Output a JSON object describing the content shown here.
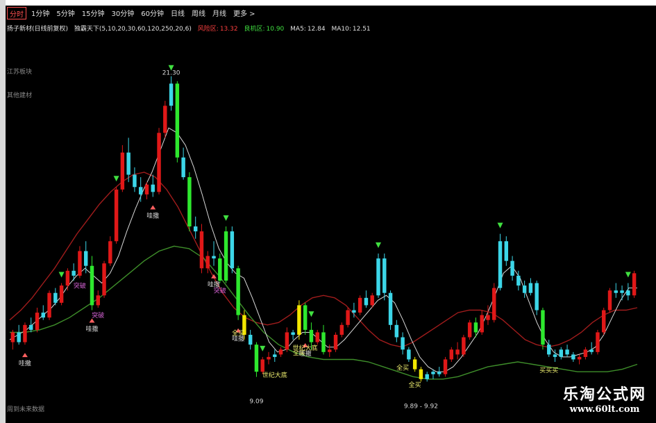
{
  "toolbar": {
    "periods": [
      "分时",
      "1分钟",
      "5分钟",
      "15分钟",
      "30分钟",
      "60分钟",
      "日线",
      "周线",
      "月线",
      "更多 >"
    ],
    "active_index": 0
  },
  "info": {
    "name": "扬子新材(日线前复权)",
    "indicator": "独霸天下(5,10,20,30,60,120,250,20,6)",
    "risk_label": "风险区:",
    "risk_value": "13.32",
    "chance_label": "良机区:",
    "chance_value": "10.90",
    "ma5_label": "MA5:",
    "ma5_value": "12.84",
    "ma10_label": "MA10:",
    "ma10_value": "12.51"
  },
  "side": {
    "block": "江苏板块",
    "industry": "其他建材",
    "future": "周到未来数据"
  },
  "watermark": {
    "title": "乐淘公式网",
    "url": "www.60lt.com"
  },
  "colors": {
    "background": "#000000",
    "up_red": "#e01818",
    "down_cyan": "#3cd6e8",
    "green_bar": "#2ee82e",
    "yellow_bar": "#f2e600",
    "red_curve": "#a01c1c",
    "green_curve": "#3e8e2a",
    "white_curve": "#d8d8d8",
    "signal_magenta": "#d060d0"
  },
  "chart_data": {
    "type": "candlestick",
    "candles": [
      {
        "o": 10.5,
        "h": 11.0,
        "l": 10.2,
        "c": 10.9,
        "k": "red"
      },
      {
        "o": 10.9,
        "h": 11.2,
        "l": 10.4,
        "c": 10.5,
        "k": "cyan"
      },
      {
        "o": 10.5,
        "h": 11.3,
        "l": 10.4,
        "c": 11.2,
        "k": "red"
      },
      {
        "o": 11.2,
        "h": 11.5,
        "l": 10.9,
        "c": 11.0,
        "k": "cyan"
      },
      {
        "o": 11.0,
        "h": 11.9,
        "l": 10.9,
        "c": 11.7,
        "k": "red"
      },
      {
        "o": 11.7,
        "h": 12.0,
        "l": 11.4,
        "c": 11.5,
        "k": "cyan"
      },
      {
        "o": 11.5,
        "h": 12.6,
        "l": 11.4,
        "c": 12.5,
        "k": "red"
      },
      {
        "o": 12.5,
        "h": 12.7,
        "l": 12.0,
        "c": 12.1,
        "k": "cyan"
      },
      {
        "o": 12.1,
        "h": 12.9,
        "l": 12.0,
        "c": 12.8,
        "k": "red"
      },
      {
        "o": 12.8,
        "h": 13.5,
        "l": 12.6,
        "c": 13.4,
        "k": "red"
      },
      {
        "o": 13.4,
        "h": 13.7,
        "l": 13.0,
        "c": 13.2,
        "k": "cyan"
      },
      {
        "o": 13.2,
        "h": 14.4,
        "l": 13.1,
        "c": 14.2,
        "k": "red"
      },
      {
        "o": 14.2,
        "h": 14.6,
        "l": 13.3,
        "c": 13.6,
        "k": "cyan"
      },
      {
        "o": 13.6,
        "h": 14.0,
        "l": 11.8,
        "c": 12.0,
        "k": "green"
      },
      {
        "o": 12.0,
        "h": 12.6,
        "l": 11.9,
        "c": 12.4,
        "k": "red"
      },
      {
        "o": 12.4,
        "h": 13.8,
        "l": 12.3,
        "c": 13.7,
        "k": "red"
      },
      {
        "o": 13.7,
        "h": 14.8,
        "l": 13.6,
        "c": 14.6,
        "k": "red"
      },
      {
        "o": 14.6,
        "h": 16.8,
        "l": 14.5,
        "c": 16.7,
        "k": "red"
      },
      {
        "o": 16.7,
        "h": 18.5,
        "l": 16.6,
        "c": 18.2,
        "k": "red"
      },
      {
        "o": 18.2,
        "h": 18.8,
        "l": 17.0,
        "c": 17.3,
        "k": "cyan"
      },
      {
        "o": 17.3,
        "h": 17.6,
        "l": 16.6,
        "c": 16.8,
        "k": "cyan"
      },
      {
        "o": 16.8,
        "h": 17.2,
        "l": 16.2,
        "c": 16.5,
        "k": "cyan"
      },
      {
        "o": 16.5,
        "h": 17.0,
        "l": 16.3,
        "c": 16.9,
        "k": "red"
      },
      {
        "o": 16.9,
        "h": 17.3,
        "l": 16.4,
        "c": 16.6,
        "k": "cyan"
      },
      {
        "o": 16.6,
        "h": 19.2,
        "l": 16.5,
        "c": 19.0,
        "k": "red"
      },
      {
        "o": 19.0,
        "h": 20.3,
        "l": 18.8,
        "c": 20.1,
        "k": "red"
      },
      {
        "o": 20.1,
        "h": 21.3,
        "l": 19.9,
        "c": 21.0,
        "k": "cyan"
      },
      {
        "o": 21.0,
        "h": 21.1,
        "l": 17.8,
        "c": 18.0,
        "k": "green"
      },
      {
        "o": 18.0,
        "h": 18.4,
        "l": 17.1,
        "c": 17.2,
        "k": "cyan"
      },
      {
        "o": 17.2,
        "h": 17.4,
        "l": 15.0,
        "c": 15.2,
        "k": "green"
      },
      {
        "o": 15.2,
        "h": 15.6,
        "l": 14.7,
        "c": 15.0,
        "k": "cyan"
      },
      {
        "o": 15.0,
        "h": 15.3,
        "l": 13.3,
        "c": 13.5,
        "k": "red"
      },
      {
        "o": 13.5,
        "h": 14.2,
        "l": 13.3,
        "c": 14.0,
        "k": "red"
      },
      {
        "o": 14.0,
        "h": 14.6,
        "l": 13.6,
        "c": 13.9,
        "k": "cyan"
      },
      {
        "o": 13.9,
        "h": 14.1,
        "l": 12.9,
        "c": 13.0,
        "k": "green"
      },
      {
        "o": 13.0,
        "h": 15.2,
        "l": 12.9,
        "c": 15.0,
        "k": "green"
      },
      {
        "o": 15.0,
        "h": 15.2,
        "l": 13.3,
        "c": 13.5,
        "k": "cyan"
      },
      {
        "o": 13.5,
        "h": 13.6,
        "l": 11.4,
        "c": 11.6,
        "k": "green"
      },
      {
        "o": 11.6,
        "h": 11.8,
        "l": 10.6,
        "c": 10.8,
        "k": "yellow"
      },
      {
        "o": 10.8,
        "h": 11.0,
        "l": 10.2,
        "c": 10.4,
        "k": "cyan"
      },
      {
        "o": 10.4,
        "h": 10.5,
        "l": 9.09,
        "c": 9.3,
        "k": "green"
      },
      {
        "o": 9.3,
        "h": 9.9,
        "l": 9.2,
        "c": 9.8,
        "k": "red"
      },
      {
        "o": 9.8,
        "h": 10.1,
        "l": 9.6,
        "c": 9.9,
        "k": "red"
      },
      {
        "o": 9.9,
        "h": 10.2,
        "l": 9.7,
        "c": 10.0,
        "k": "cyan"
      },
      {
        "o": 10.0,
        "h": 10.3,
        "l": 9.9,
        "c": 10.2,
        "k": "red"
      },
      {
        "o": 10.2,
        "h": 11.1,
        "l": 10.1,
        "c": 10.9,
        "k": "red"
      },
      {
        "o": 10.9,
        "h": 11.0,
        "l": 10.6,
        "c": 10.8,
        "k": "cyan"
      },
      {
        "o": 10.8,
        "h": 12.2,
        "l": 10.6,
        "c": 12.0,
        "k": "yellow"
      },
      {
        "o": 12.0,
        "h": 12.1,
        "l": 10.8,
        "c": 11.0,
        "k": "green"
      },
      {
        "o": 11.0,
        "h": 11.3,
        "l": 10.2,
        "c": 10.5,
        "k": "green"
      },
      {
        "o": 10.5,
        "h": 11.0,
        "l": 10.4,
        "c": 10.9,
        "k": "red"
      },
      {
        "o": 10.9,
        "h": 11.2,
        "l": 10.0,
        "c": 10.1,
        "k": "green"
      },
      {
        "o": 10.1,
        "h": 10.4,
        "l": 9.9,
        "c": 10.2,
        "k": "red"
      },
      {
        "o": 10.2,
        "h": 10.9,
        "l": 10.1,
        "c": 10.8,
        "k": "red"
      },
      {
        "o": 10.8,
        "h": 11.3,
        "l": 10.7,
        "c": 11.2,
        "k": "red"
      },
      {
        "o": 11.2,
        "h": 11.9,
        "l": 11.1,
        "c": 11.8,
        "k": "red"
      },
      {
        "o": 11.8,
        "h": 12.1,
        "l": 11.5,
        "c": 11.7,
        "k": "cyan"
      },
      {
        "o": 11.7,
        "h": 12.4,
        "l": 11.6,
        "c": 12.3,
        "k": "red"
      },
      {
        "o": 12.3,
        "h": 12.6,
        "l": 11.9,
        "c": 12.0,
        "k": "cyan"
      },
      {
        "o": 12.0,
        "h": 12.5,
        "l": 11.9,
        "c": 12.4,
        "k": "red"
      },
      {
        "o": 12.4,
        "h": 14.1,
        "l": 12.3,
        "c": 13.9,
        "k": "cyan"
      },
      {
        "o": 13.9,
        "h": 14.1,
        "l": 12.2,
        "c": 12.5,
        "k": "cyan"
      },
      {
        "o": 12.5,
        "h": 12.6,
        "l": 11.0,
        "c": 11.2,
        "k": "cyan"
      },
      {
        "o": 11.2,
        "h": 11.4,
        "l": 10.5,
        "c": 10.7,
        "k": "cyan"
      },
      {
        "o": 10.7,
        "h": 10.9,
        "l": 10.0,
        "c": 10.2,
        "k": "cyan"
      },
      {
        "o": 10.2,
        "h": 10.3,
        "l": 9.7,
        "c": 9.8,
        "k": "cyan"
      },
      {
        "o": 9.8,
        "h": 9.9,
        "l": 9.3,
        "c": 9.4,
        "k": "yellow"
      },
      {
        "o": 9.4,
        "h": 9.5,
        "l": 8.9,
        "c": 9.0,
        "k": "yellow"
      },
      {
        "o": 9.0,
        "h": 9.3,
        "l": 8.9,
        "c": 9.2,
        "k": "cyan"
      },
      {
        "o": 9.2,
        "h": 9.4,
        "l": 9.0,
        "c": 9.3,
        "k": "cyan"
      },
      {
        "o": 9.3,
        "h": 9.5,
        "l": 9.1,
        "c": 9.2,
        "k": "cyan"
      },
      {
        "o": 9.2,
        "h": 9.9,
        "l": 9.1,
        "c": 9.8,
        "k": "red"
      },
      {
        "o": 9.8,
        "h": 10.3,
        "l": 9.7,
        "c": 10.2,
        "k": "red"
      },
      {
        "o": 10.2,
        "h": 10.5,
        "l": 9.8,
        "c": 10.0,
        "k": "red"
      },
      {
        "o": 10.0,
        "h": 10.8,
        "l": 9.9,
        "c": 10.7,
        "k": "red"
      },
      {
        "o": 10.7,
        "h": 11.4,
        "l": 10.6,
        "c": 11.3,
        "k": "red"
      },
      {
        "o": 11.3,
        "h": 11.5,
        "l": 10.7,
        "c": 10.9,
        "k": "green"
      },
      {
        "o": 10.9,
        "h": 11.8,
        "l": 10.8,
        "c": 11.6,
        "k": "red"
      },
      {
        "o": 11.6,
        "h": 12.0,
        "l": 11.2,
        "c": 11.4,
        "k": "red"
      },
      {
        "o": 11.4,
        "h": 12.9,
        "l": 11.3,
        "c": 12.7,
        "k": "red"
      },
      {
        "o": 12.7,
        "h": 14.9,
        "l": 12.6,
        "c": 14.6,
        "k": "cyan"
      },
      {
        "o": 14.6,
        "h": 14.8,
        "l": 13.6,
        "c": 13.8,
        "k": "cyan"
      },
      {
        "o": 13.8,
        "h": 14.0,
        "l": 13.0,
        "c": 13.2,
        "k": "cyan"
      },
      {
        "o": 13.2,
        "h": 13.4,
        "l": 12.6,
        "c": 12.8,
        "k": "cyan"
      },
      {
        "o": 12.8,
        "h": 13.0,
        "l": 12.3,
        "c": 12.5,
        "k": "cyan"
      },
      {
        "o": 12.5,
        "h": 13.1,
        "l": 12.4,
        "c": 12.9,
        "k": "cyan"
      },
      {
        "o": 12.9,
        "h": 13.0,
        "l": 11.6,
        "c": 11.8,
        "k": "cyan"
      },
      {
        "o": 11.8,
        "h": 11.9,
        "l": 10.2,
        "c": 10.4,
        "k": "green"
      },
      {
        "o": 10.4,
        "h": 10.6,
        "l": 9.9,
        "c": 10.0,
        "k": "cyan"
      },
      {
        "o": 10.0,
        "h": 10.2,
        "l": 9.7,
        "c": 9.9,
        "k": "cyan"
      },
      {
        "o": 9.9,
        "h": 10.3,
        "l": 9.8,
        "c": 10.2,
        "k": "cyan"
      },
      {
        "o": 10.2,
        "h": 10.4,
        "l": 9.9,
        "c": 10.0,
        "k": "cyan"
      },
      {
        "o": 10.0,
        "h": 10.1,
        "l": 9.7,
        "c": 9.8,
        "k": "cyan"
      },
      {
        "o": 9.8,
        "h": 10.0,
        "l": 9.6,
        "c": 9.9,
        "k": "red"
      },
      {
        "o": 9.9,
        "h": 10.3,
        "l": 9.8,
        "c": 10.2,
        "k": "red"
      },
      {
        "o": 10.2,
        "h": 10.5,
        "l": 10.0,
        "c": 10.1,
        "k": "cyan"
      },
      {
        "o": 10.1,
        "h": 11.0,
        "l": 10.0,
        "c": 10.9,
        "k": "red"
      },
      {
        "o": 10.9,
        "h": 11.9,
        "l": 10.8,
        "c": 11.8,
        "k": "red"
      },
      {
        "o": 11.8,
        "h": 12.7,
        "l": 11.7,
        "c": 12.6,
        "k": "red"
      },
      {
        "o": 12.6,
        "h": 12.9,
        "l": 12.3,
        "c": 12.5,
        "k": "cyan"
      },
      {
        "o": 12.5,
        "h": 12.8,
        "l": 12.2,
        "c": 12.6,
        "k": "cyan"
      },
      {
        "o": 12.6,
        "h": 12.9,
        "l": 12.2,
        "c": 12.4,
        "k": "cyan"
      },
      {
        "o": 12.4,
        "h": 13.4,
        "l": 12.3,
        "c": 13.3,
        "k": "red"
      }
    ],
    "curves": [
      {
        "name": "red",
        "y": [
          11.4,
          11.8,
          12.3,
          12.9,
          13.5,
          14.2,
          14.9,
          15.5,
          16.1,
          16.6,
          17.0,
          17.3,
          17.4,
          17.2,
          16.7,
          16.0,
          15.1,
          14.2,
          13.3,
          12.5,
          11.9,
          11.5,
          11.3,
          11.2,
          11.3,
          11.6,
          12.0,
          12.3,
          12.4,
          12.3,
          12.0,
          11.5,
          11.0,
          10.6,
          10.4,
          10.3,
          10.5,
          10.8,
          11.1,
          11.4,
          11.7,
          11.8,
          11.8,
          11.7,
          11.4,
          11.0,
          10.6,
          10.4,
          10.3,
          10.4,
          10.6,
          10.9,
          11.3,
          11.6,
          11.8,
          11.8,
          11.9
        ]
      },
      {
        "name": "green",
        "y": [
          10.9,
          10.9,
          11.0,
          11.2,
          11.5,
          11.9,
          12.3,
          12.8,
          13.3,
          13.8,
          14.2,
          14.4,
          14.3,
          13.9,
          13.2,
          12.4,
          11.6,
          10.9,
          10.4,
          10.1,
          9.9,
          9.8,
          9.8,
          9.8,
          9.7,
          9.5,
          9.3,
          9.1,
          9.0,
          9.0,
          9.1,
          9.3,
          9.5,
          9.6,
          9.7,
          9.6,
          9.5,
          9.4,
          9.3,
          9.3,
          9.3,
          9.4,
          9.6
        ]
      }
    ],
    "white_line": [
      10.6,
      10.8,
      11.0,
      11.3,
      11.6,
      11.9,
      12.3,
      12.8,
      13.2,
      13.5,
      13.2,
      12.9,
      13.3,
      14.0,
      15.0,
      15.9,
      16.7,
      17.4,
      18.3,
      19.2,
      19.0,
      18.5,
      17.6,
      16.5,
      15.3,
      14.3,
      13.7,
      13.3,
      13.1,
      12.3,
      11.4,
      10.5,
      10.1,
      10.2,
      10.6,
      10.9,
      10.9,
      10.6,
      10.3,
      10.3,
      10.6,
      11.0,
      11.4,
      11.8,
      12.2,
      12.4,
      12.1,
      11.4,
      10.6,
      9.9,
      9.5,
      9.3,
      9.3,
      9.5,
      9.9,
      10.4,
      10.9,
      11.6,
      12.4,
      13.3,
      13.6,
      13.1,
      12.2,
      11.3,
      10.6,
      10.1,
      9.9,
      9.9,
      10.0,
      10.1,
      10.3,
      10.8,
      11.5,
      12.2,
      12.7,
      12.7
    ],
    "signals": {
      "buy_labels": [
        {
          "i": 2,
          "text": "哇撒"
        },
        {
          "i": 13,
          "text": "哇撒"
        },
        {
          "i": 23,
          "text": "哇撒"
        },
        {
          "i": 33,
          "text": "哇撒"
        },
        {
          "i": 37,
          "text": "哇撒"
        },
        {
          "i": 48,
          "text": "哇撒"
        }
      ],
      "magenta_labels": [
        {
          "i": 11,
          "text": "突破"
        },
        {
          "i": 14,
          "text": "突破"
        },
        {
          "i": 34,
          "text": "突破"
        }
      ],
      "yellow_labels": [
        {
          "i": 37,
          "text": "全买"
        },
        {
          "i": 43,
          "text": "世纪大底"
        },
        {
          "i": 47,
          "text": "全买"
        },
        {
          "i": 48,
          "text": "世纪大底"
        },
        {
          "i": 64,
          "text": "全买"
        },
        {
          "i": 66,
          "text": "全买"
        },
        {
          "i": 88,
          "text": "买买买"
        }
      ],
      "low_annotations": [
        {
          "i": 40,
          "text": "9.09"
        },
        {
          "i": 67,
          "text": "9.89 - 9.92"
        }
      ],
      "high_annotation": {
        "i": 26,
        "text": "21.30"
      }
    },
    "ylim": [
      8.6,
      21.8
    ]
  }
}
